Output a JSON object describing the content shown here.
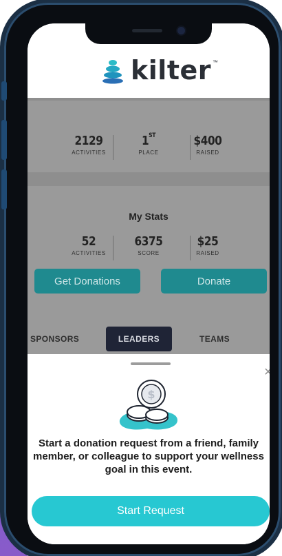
{
  "brand": {
    "name": "kilter",
    "tm": "™"
  },
  "event_stats": [
    {
      "value": "2129",
      "sup": "",
      "label": "ACTIVITIES"
    },
    {
      "value": "1",
      "sup": "ST",
      "label": "PLACE"
    },
    {
      "value": "$400",
      "sup": "",
      "label": "RAISED"
    }
  ],
  "my_stats": {
    "title": "My Stats",
    "items": [
      {
        "value": "52",
        "label": "ACTIVITIES"
      },
      {
        "value": "6375",
        "label": "SCORE"
      },
      {
        "value": "$25",
        "label": "RAISED"
      }
    ],
    "get_donations_label": "Get Donations",
    "donate_label": "Donate"
  },
  "tabs": [
    {
      "label": "SPONSORS",
      "active": false
    },
    {
      "label": "LEADERS",
      "active": true
    },
    {
      "label": "TEAMS",
      "active": false
    }
  ],
  "sheet": {
    "close_label": "×",
    "message": "Start a donation request from a friend, family member, or colleague to support your wellness goal in this event.",
    "start_label": "Start Request"
  },
  "colors": {
    "teal": "#27c8d2",
    "teal_dimmed": "#1f8a8f",
    "tab_active": "#1f2436",
    "overlay_gray": "#8e8e8e"
  },
  "icons": {
    "logo": "stacked-stones-icon",
    "illustration": "coins-stack-icon"
  }
}
